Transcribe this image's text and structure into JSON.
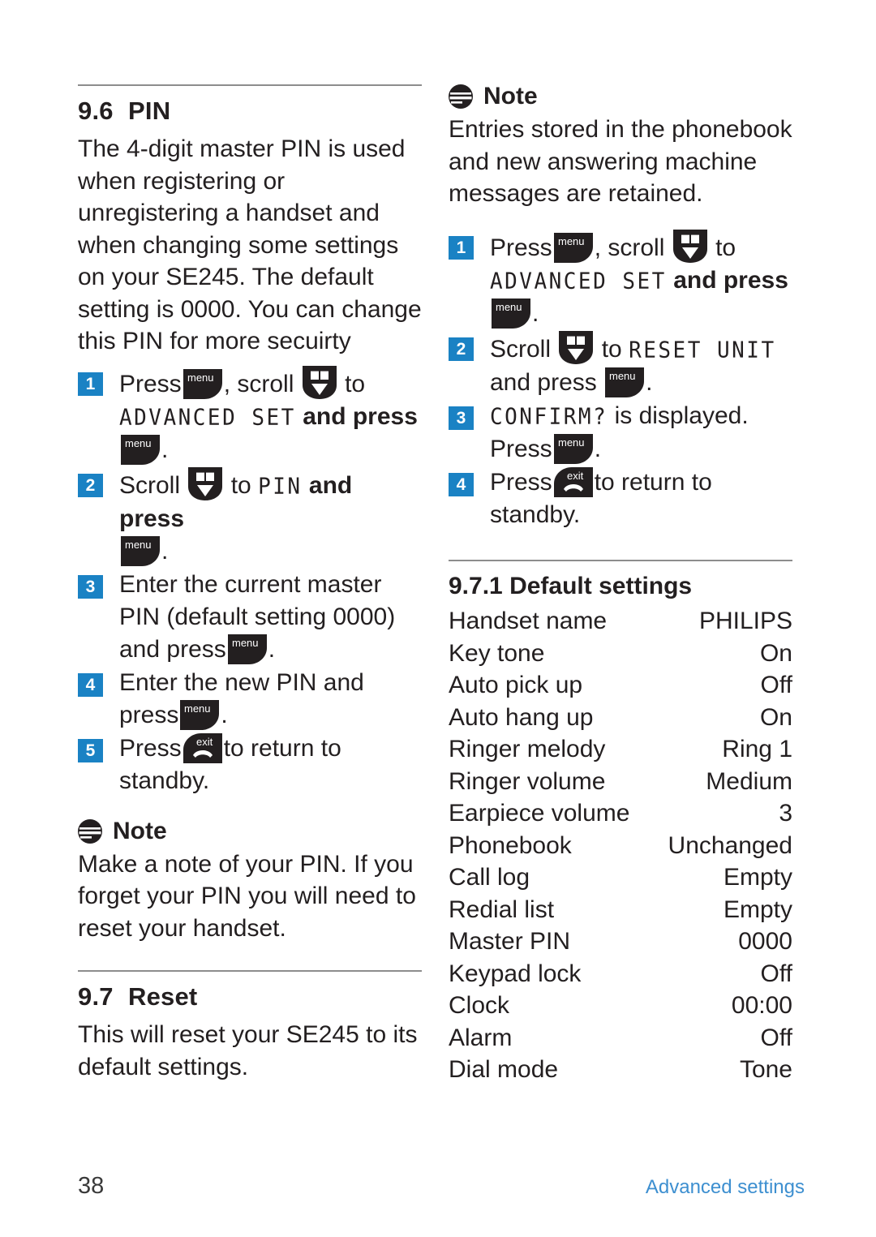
{
  "left_column": {
    "section": {
      "number": "9.6",
      "title": "PIN"
    },
    "intro": "The 4-digit master PIN is used when registering or unregistering a handset and when changing some settings on your SE245. The default setting is 0000. You can change this PIN for more secuirty",
    "steps": [
      {
        "badge": "1",
        "part1": "Press",
        "key1": "menu",
        "part2": ", scroll",
        "key2": "scroll-down",
        "part3": "to",
        "lcd": "ADVANCED SET",
        "part4": "and press",
        "key3": "menu",
        "part5": "."
      },
      {
        "badge": "2",
        "part1": "Scroll",
        "key1": "scroll-down",
        "part2": "to",
        "lcd": "PIN",
        "part3": "and press",
        "key2": "menu",
        "part4": "."
      },
      {
        "badge": "3",
        "part1": "Enter the current master PIN (default setting 0000) and press",
        "key1": "menu",
        "part2": "."
      },
      {
        "badge": "4",
        "part1": "Enter the new PIN and press",
        "key1": "menu",
        "part2": "."
      },
      {
        "badge": "5",
        "part1": "Press",
        "key1": "exit",
        "part2": "to return to standby."
      }
    ],
    "note": {
      "title": "Note",
      "body": "Make a note of your PIN. If you forget your PIN you will need to reset your handset."
    },
    "reset_section": {
      "number": "9.7",
      "title": "Reset"
    },
    "reset_body": "This will reset your SE245 to its default settings."
  },
  "right_column": {
    "note": {
      "title": "Note",
      "body": "Entries stored in the phonebook and new answering machine messages are retained."
    },
    "steps": [
      {
        "badge": "1",
        "part1": "Press",
        "key1": "menu",
        "part2": ", scroll",
        "key2": "scroll-down",
        "part3": "to",
        "lcd": "ADVANCED SET",
        "part4": "and press",
        "key3": "menu",
        "part5": "."
      },
      {
        "badge": "2",
        "part1": "Scroll",
        "key1": "scroll-down",
        "part2": "to",
        "lcd": "RESET UNIT",
        "part3": "and press",
        "key2": "menu",
        "part4": "."
      },
      {
        "badge": "3",
        "lcd": "CONFIRM?",
        "part1": "is displayed. Press",
        "key1": "menu",
        "part2": "."
      },
      {
        "badge": "4",
        "part1": "Press",
        "key1": "exit",
        "part2": "to return to standby."
      }
    ],
    "subsection": {
      "number": "9.7.1",
      "title": "Default settings"
    },
    "settings_table": [
      {
        "name": "Handset name",
        "value": "PHILIPS"
      },
      {
        "name": "Key tone",
        "value": "On"
      },
      {
        "name": "Auto pick up",
        "value": "Off"
      },
      {
        "name": "Auto hang up",
        "value": "On"
      },
      {
        "name": "Ringer melody",
        "value": "Ring 1"
      },
      {
        "name": "Ringer volume",
        "value": "Medium"
      },
      {
        "name": "Earpiece volume",
        "value": "3"
      },
      {
        "name": "Phonebook",
        "value": "Unchanged"
      },
      {
        "name": "Call log",
        "value": "Empty"
      },
      {
        "name": "Redial list",
        "value": "Empty"
      },
      {
        "name": "Master PIN",
        "value": "0000"
      },
      {
        "name": "Keypad lock",
        "value": "Off"
      },
      {
        "name": "Clock",
        "value": "00:00"
      },
      {
        "name": "Alarm",
        "value": "Off"
      },
      {
        "name": "Dial mode",
        "value": "Tone"
      }
    ]
  },
  "footer": {
    "page_number": "38",
    "label": "Advanced settings"
  },
  "keys": {
    "menu_label": "menu",
    "exit_label": "exit"
  },
  "colors": {
    "badge_blue": "#1a82c4",
    "footer_blue": "#3d8fd0",
    "rule_gray": "#8d8d8d",
    "text": "#231f20",
    "icon_dark": "#231f20"
  }
}
